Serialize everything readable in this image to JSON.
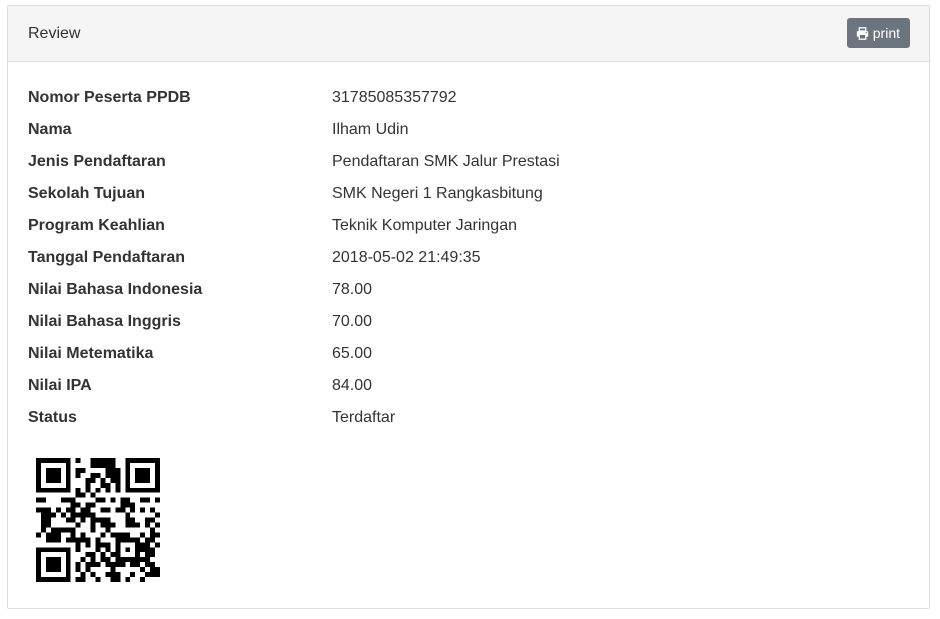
{
  "panel": {
    "title": "Review",
    "print_label": "print",
    "print_icon": "print-icon"
  },
  "details": [
    {
      "label": "Nomor Peserta PPDB",
      "value": "31785085357792"
    },
    {
      "label": "Nama",
      "value": "Ilham Udin"
    },
    {
      "label": "Jenis Pendaftaran",
      "value": "Pendaftaran SMK Jalur Prestasi"
    },
    {
      "label": "Sekolah Tujuan",
      "value": "SMK Negeri 1 Rangkasbitung"
    },
    {
      "label": "Program Keahlian",
      "value": "Teknik Komputer Jaringan"
    },
    {
      "label": "Tanggal Pendaftaran",
      "value": "2018-05-02 21:49:35"
    },
    {
      "label": "Nilai Bahasa Indonesia",
      "value": "78.00"
    },
    {
      "label": "Nilai Bahasa Inggris",
      "value": "70.00"
    },
    {
      "label": "Nilai Metematika",
      "value": "65.00"
    },
    {
      "label": "Nilai IPA",
      "value": "84.00"
    },
    {
      "label": "Status",
      "value": "Terdaftar"
    }
  ],
  "qr_code": {
    "icon": "qr-code",
    "color": "#000000"
  }
}
